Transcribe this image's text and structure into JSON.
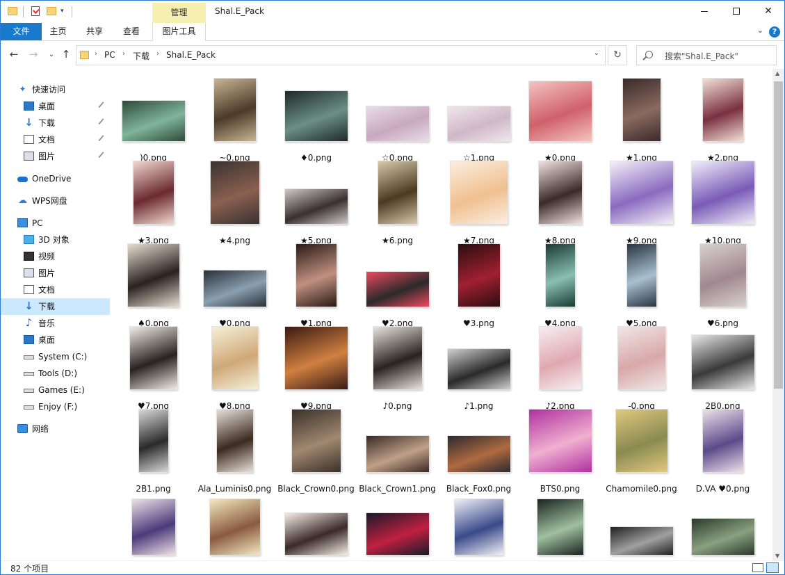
{
  "window": {
    "title": "Shal.E_Pack",
    "context_tab": "管理",
    "controls": {
      "minimize": "minimize-icon",
      "maximize": "maximize-icon",
      "close": "✕"
    }
  },
  "ribbon": {
    "tabs": [
      "文件",
      "主页",
      "共享",
      "查看",
      "图片工具"
    ],
    "help": "?"
  },
  "address": {
    "crumbs": [
      "PC",
      "下载",
      "Shal.E_Pack"
    ],
    "search_placeholder": "搜索\"Shal.E_Pack\""
  },
  "nav": {
    "items": [
      {
        "label": "快速访问",
        "icon": "star-icon",
        "pinned": false
      },
      {
        "label": "桌面",
        "icon": "desktop-icon",
        "pinned": true
      },
      {
        "label": "下载",
        "icon": "download-icon",
        "pinned": true
      },
      {
        "label": "文档",
        "icon": "document-icon",
        "pinned": true
      },
      {
        "label": "图片",
        "icon": "pictures-icon",
        "pinned": true
      },
      {
        "label": "OneDrive",
        "icon": "cloud-icon",
        "pinned": false
      },
      {
        "label": "WPS网盘",
        "icon": "wps-cloud-icon",
        "pinned": false
      },
      {
        "label": "PC",
        "icon": "pc-icon",
        "pinned": false
      },
      {
        "label": "3D 对象",
        "icon": "3d-objects-icon",
        "pinned": false
      },
      {
        "label": "视频",
        "icon": "video-icon",
        "pinned": false
      },
      {
        "label": "图片",
        "icon": "pictures-icon",
        "pinned": false
      },
      {
        "label": "文档",
        "icon": "document-icon",
        "pinned": false
      },
      {
        "label": "下载",
        "icon": "download-icon",
        "pinned": false,
        "selected": true
      },
      {
        "label": "音乐",
        "icon": "music-icon",
        "pinned": false
      },
      {
        "label": "桌面",
        "icon": "desktop-icon",
        "pinned": false
      },
      {
        "label": "System (C:)",
        "icon": "drive-icon",
        "pinned": false
      },
      {
        "label": "Tools (D:)",
        "icon": "drive-icon",
        "pinned": false
      },
      {
        "label": "Games (E:)",
        "icon": "drive-icon",
        "pinned": false
      },
      {
        "label": "Enjoy (F:)",
        "icon": "drive-icon",
        "pinned": false
      },
      {
        "label": "网络",
        "icon": "network-icon",
        "pinned": false
      }
    ]
  },
  "files": [
    {
      "name": ")0.png",
      "colors": [
        "#2f4a3a",
        "#7fb59a"
      ]
    },
    {
      "name": "~0.png",
      "colors": [
        "#c9b594",
        "#4a3a28"
      ]
    },
    {
      "name": "♦0.png",
      "colors": [
        "#1e2a28",
        "#6b8f85"
      ]
    },
    {
      "name": "☆0.png",
      "colors": [
        "#e8dde8",
        "#c8a8c0"
      ]
    },
    {
      "name": "☆1.png",
      "colors": [
        "#f0e6ec",
        "#cfb8c8"
      ]
    },
    {
      "name": "★0.png",
      "colors": [
        "#f3c4c0",
        "#d0606a"
      ]
    },
    {
      "name": "★1.png",
      "colors": [
        "#3a2a2a",
        "#8a6a60"
      ]
    },
    {
      "name": "★2.png",
      "colors": [
        "#f2e0d6",
        "#7a3040"
      ]
    },
    {
      "name": "★3.png",
      "colors": [
        "#f2d6d0",
        "#6a2a30"
      ]
    },
    {
      "name": "★4.png",
      "colors": [
        "#3a3230",
        "#8a6050"
      ]
    },
    {
      "name": "★5.png",
      "colors": [
        "#cfc8c8",
        "#3a3030"
      ]
    },
    {
      "name": "★6.png",
      "colors": [
        "#d6c8a8",
        "#4a3a22"
      ]
    },
    {
      "name": "★7.png",
      "colors": [
        "#fbeee0",
        "#f0c090"
      ]
    },
    {
      "name": "★8.png",
      "colors": [
        "#f0e0e0",
        "#3a2a2a"
      ]
    },
    {
      "name": "★9.png",
      "colors": [
        "#f4f0f8",
        "#8a6ac0"
      ]
    },
    {
      "name": "★10.png",
      "colors": [
        "#f0eef8",
        "#7a5ab8"
      ]
    },
    {
      "name": "♠0.png",
      "colors": [
        "#e6dcd0",
        "#2a2220"
      ]
    },
    {
      "name": "♥0.png",
      "colors": [
        "#2a3038",
        "#8aa0b0"
      ]
    },
    {
      "name": "♥1.png",
      "colors": [
        "#2a1a16",
        "#c09080"
      ]
    },
    {
      "name": "♥2.png",
      "colors": [
        "#f04860",
        "#2a2a2a"
      ]
    },
    {
      "name": "♥3.png",
      "colors": [
        "#2a0e10",
        "#a02030"
      ]
    },
    {
      "name": "♥4.png",
      "colors": [
        "#1a3a34",
        "#8ac0b0"
      ]
    },
    {
      "name": "♥5.png",
      "colors": [
        "#2a3440",
        "#a8c0d0"
      ]
    },
    {
      "name": "♥6.png",
      "colors": [
        "#d8d0d0",
        "#a08890"
      ]
    },
    {
      "name": "♥7.png",
      "colors": [
        "#f0ece8",
        "#2a2220"
      ]
    },
    {
      "name": "♥8.png",
      "colors": [
        "#f4f0d8",
        "#d0a878"
      ]
    },
    {
      "name": "♥9.png",
      "colors": [
        "#3a1a14",
        "#d08040"
      ]
    },
    {
      "name": "♪0.png",
      "colors": [
        "#e8e4e0",
        "#2a2220"
      ]
    },
    {
      "name": "♪1.png",
      "colors": [
        "#d0d0d0",
        "#2a2a2a"
      ]
    },
    {
      "name": "♪2.png",
      "colors": [
        "#f6eef0",
        "#e0a8b0"
      ]
    },
    {
      "name": "-0.png",
      "colors": [
        "#f0e6e6",
        "#d8a8a8"
      ]
    },
    {
      "name": "2B0.png",
      "colors": [
        "#e8e8e8",
        "#3a3a3a"
      ]
    },
    {
      "name": "2B1.png",
      "colors": [
        "#d8d8d8",
        "#2a2a2a"
      ]
    },
    {
      "name": "Ala_Luminis0.png",
      "colors": [
        "#e8e0d8",
        "#3a2a20"
      ]
    },
    {
      "name": "Black_Crown0.png",
      "colors": [
        "#3a302a",
        "#a08870"
      ]
    },
    {
      "name": "Black_Crown1.png",
      "colors": [
        "#3a2a24",
        "#c0a088"
      ]
    },
    {
      "name": "Black_Fox0.png",
      "colors": [
        "#2a2a30",
        "#b06a40"
      ]
    },
    {
      "name": "BTS0.png",
      "colors": [
        "#b030a0",
        "#f0b0d0"
      ]
    },
    {
      "name": "Chamomile0.png",
      "colors": [
        "#e0c880",
        "#8a8a50"
      ]
    },
    {
      "name": "D.VA ♥0.png",
      "colors": [
        "#f0e0ea",
        "#5a4a8a"
      ]
    },
    {
      "name": "",
      "colors": [
        "#f0e0e8",
        "#4a3a7a"
      ]
    },
    {
      "name": "",
      "colors": [
        "#f4e8c0",
        "#8a5a40"
      ]
    },
    {
      "name": "",
      "colors": [
        "#f6eee6",
        "#3a2a28"
      ]
    },
    {
      "name": "",
      "colors": [
        "#1a1a2a",
        "#c02040"
      ]
    },
    {
      "name": "",
      "colors": [
        "#f0f0f6",
        "#3a4a8a"
      ]
    },
    {
      "name": "",
      "colors": [
        "#1a2420",
        "#a0c0a0"
      ]
    },
    {
      "name": "",
      "colors": [
        "#202020",
        "#a0a0a0"
      ]
    },
    {
      "name": "",
      "colors": [
        "#2a3a2a",
        "#8aa080"
      ]
    }
  ],
  "status": {
    "count": "82 个项目"
  }
}
